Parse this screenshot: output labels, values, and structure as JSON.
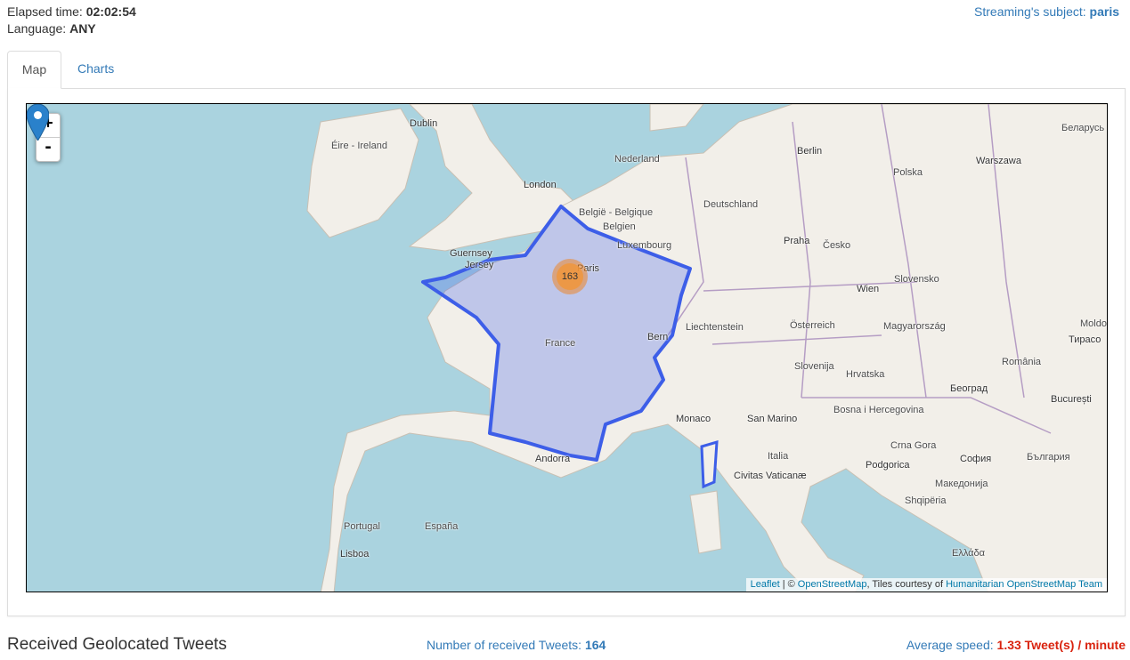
{
  "status": {
    "elapsed_label": "Elapsed time:",
    "elapsed_value": "02:02:54",
    "language_label": "Language:",
    "language_value": "ANY",
    "subject_label": "Streaming's subject:",
    "subject_value": "paris"
  },
  "tabs": [
    {
      "label": "Map",
      "active": true
    },
    {
      "label": "Charts",
      "active": false
    }
  ],
  "map": {
    "zoom_in": "+",
    "zoom_out": "-",
    "cluster_count": "163",
    "attribution": {
      "leaflet": "Leaflet",
      "separator": " | © ",
      "osm": "OpenStreetMap",
      "tiles_text": ", Tiles courtesy of ",
      "hot": "Humanitarian OpenStreetMap Team"
    },
    "labels": {
      "dublin": "Dublin",
      "eire": "Éire - Ireland",
      "london": "London",
      "nederland": "Nederland",
      "belgie": "België - Belgique",
      "belgien": "Belgien",
      "luxembourg": "Luxembourg",
      "deutschland": "Deutschland",
      "berlin": "Berlin",
      "polska": "Polska",
      "warszawa": "Warszawa",
      "belarus": "Беларусь",
      "guernsey": "Guernsey",
      "jersey": "Jersey",
      "paris": "Paris",
      "france": "France",
      "praha": "Praha",
      "cesko": "Česko",
      "wien": "Wien",
      "slovensko": "Slovensko",
      "liechtenstein": "Liechtenstein",
      "osterreich": "Österreich",
      "magyarorszag": "Magyarország",
      "moldova": "Moldo",
      "tiraspol": "Тирасо",
      "bern": "Bern",
      "slovenija": "Slovenija",
      "hrvatska": "Hrvatska",
      "romania": "România",
      "beograd": "Београд",
      "bucuresti": "București",
      "bosna": "Bosna i Hercegovina",
      "monaco": "Monaco",
      "san_marino": "San Marino",
      "crna_gora": "Crna Gora",
      "italia": "Italia",
      "podgorica": "Podgorica",
      "sofia": "София",
      "bulgaria": "България",
      "andorra": "Andorra",
      "vaticano": "Civitas Vaticanæ",
      "makedonija": "Македонија",
      "shqiperia": "Shqipëria",
      "portugal": "Portugal",
      "espana": "España",
      "lisboa": "Lisboa",
      "ellada": "Ελλάδα"
    }
  },
  "footer": {
    "title": "Received Geolocated Tweets",
    "count_label": "Number of received Tweets:",
    "count_value": "164",
    "speed_label": "Average speed:",
    "speed_value": "1.33 Tweet(s) / minute"
  },
  "colors": {
    "link": "#337ab7",
    "speed": "#d9230f",
    "sea": "#aad3df",
    "land": "#f2efe9",
    "region": "#3d5ee8"
  }
}
